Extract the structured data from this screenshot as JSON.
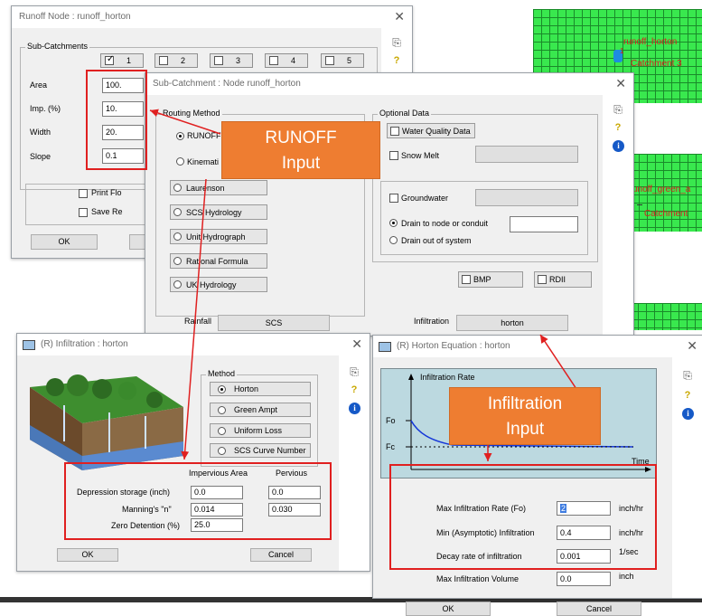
{
  "map": {
    "node_label_1": "runoff_horton",
    "node_tag_1": "1",
    "catch_label_1": "Catchment 3",
    "node_label_2": "unoff_green_a",
    "catch_label_2": "Catchment"
  },
  "runoff_node": {
    "title": "Runoff Node : runoff_horton",
    "subcatch_group": "Sub-Catchments",
    "tabs": [
      "1",
      "2",
      "3",
      "4",
      "5"
    ],
    "area_label": "Area",
    "area_value": "100.",
    "imp_label": "Imp. (%)",
    "imp_value": "10.",
    "width_label": "Width",
    "width_value": "20.",
    "slope_label": "Slope",
    "slope_value": "0.1",
    "print_label": "Print Flo",
    "save_label": "Save Re",
    "ok_label": "OK"
  },
  "subcatch": {
    "title": "Sub-Catchment : Node runoff_horton",
    "routing_group": "Routing Method",
    "runoff_label": "RUNOFF",
    "kinematic_label": "Kinemati",
    "methods": [
      "Laurenson",
      "SCS Hydrology",
      "Unit Hydrograph",
      "Rational Formula",
      "UK Hydrology"
    ],
    "optional_group": "Optional Data",
    "water_quality": "Water Quality Data",
    "snow_melt": "Snow Melt",
    "groundwater": "Groundwater",
    "drain_node": "Drain to node or conduit",
    "drain_out": "Drain out of system",
    "bmp_label": "BMP",
    "rdii_label": "RDII",
    "rainfall_label": "Rainfall",
    "rainfall_button": "SCS",
    "infiltration_label": "Infiltration",
    "infiltration_button": "horton"
  },
  "infil_dialog": {
    "title": "(R) Infiltration : horton",
    "method_group": "Method",
    "methods": [
      "Horton",
      "Green Ampt",
      "Uniform Loss",
      "SCS Curve Number"
    ],
    "col_impervious": "Impervious Area",
    "col_pervious": "Pervious",
    "depression_label": "Depression storage   (inch)",
    "depression_imp": "0.0",
    "depression_perv": "0.0",
    "manning_label": "Manning's \"n\"",
    "manning_imp": "0.014",
    "manning_perv": "0.030",
    "zero_label": "Zero Detention (%)",
    "zero_value": "25.0",
    "ok_label": "OK",
    "cancel_label": "Cancel"
  },
  "horton_dialog": {
    "title": "(R) Horton Equation : horton",
    "chart_title": "Infiltration Rate",
    "fo_label": "Fo",
    "fc_label": "Fc",
    "time_label": "Time",
    "max_rate_label": "Max Infiltration Rate (Fo)",
    "max_rate_value": "2",
    "max_rate_unit": "inch/hr",
    "min_rate_label": "Min (Asymptotic) Infiltration",
    "min_rate_value": "0.4",
    "min_rate_unit": "inch/hr",
    "decay_label": "Decay rate of infiltration",
    "decay_value": "0.001",
    "decay_unit": "1/sec",
    "max_vol_label": "Max Infiltration Volume",
    "max_vol_value": "0.0",
    "max_vol_unit": "inch",
    "ok_label": "OK",
    "cancel_label": "Cancel"
  },
  "callouts": {
    "runoff": [
      "RUNOFF",
      "Input"
    ],
    "infiltration": [
      "Infiltration",
      "Input"
    ]
  },
  "colors": {
    "callout": "#ee7d31",
    "highlight": "#e02020",
    "grid": "#39e84e"
  }
}
